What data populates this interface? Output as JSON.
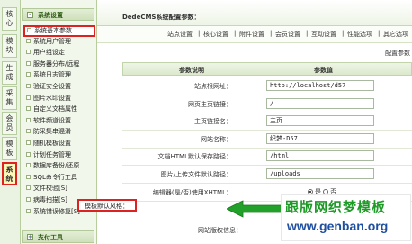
{
  "vtabs": [
    {
      "label": "核心",
      "active": false
    },
    {
      "label": "模块",
      "active": false
    },
    {
      "label": "生成",
      "active": false
    },
    {
      "label": "采集",
      "active": false
    },
    {
      "label": "会员",
      "active": false
    },
    {
      "label": "模板",
      "active": false
    },
    {
      "label": "系统",
      "active": true
    }
  ],
  "menu": {
    "section1": "系统设置",
    "items": [
      "系统基本参数",
      "系统用户管理",
      "用户组设定",
      "服务器分布/远程",
      "系统日志管理",
      "验证安全设置",
      "图片水印设置",
      "自定义文档属性",
      "软件频道设置",
      "防采集串混淆",
      "随机模板设置",
      "计划任务管理",
      "数据库备份/还原",
      "SQL命令行工具",
      "文件校验[S]",
      "病毒扫描[S]",
      "系统错误修复[S]"
    ],
    "section2": "支付工具"
  },
  "main": {
    "title": "DedeCMS系统配置参数：",
    "tabs": [
      "站点设置",
      "|",
      "核心设置",
      "|",
      "附件设置",
      "|",
      "会员设置",
      "|",
      "互动设置",
      "|",
      "性能选项",
      "|",
      "其它选项"
    ],
    "section_title": "配置参数",
    "grid": {
      "col1": "参数说明",
      "col2": "参数值",
      "rows": [
        {
          "label": "站点根网址：",
          "value": "http://localhost/d57",
          "type": "input"
        },
        {
          "label": "网页主页链接：",
          "value": "/",
          "type": "input"
        },
        {
          "label": "主页链接名：",
          "value": "主页",
          "type": "input"
        },
        {
          "label": "网站名称：",
          "value": "织梦-D57",
          "type": "input"
        },
        {
          "label": "文档HTML默认保存路径：",
          "value": "/html",
          "type": "input"
        },
        {
          "label": "图片/上传文件默认路径：",
          "value": "/uploads",
          "type": "input"
        },
        {
          "label": "编辑器(是/否)使用XHTML：",
          "value": "",
          "type": "radio"
        }
      ],
      "radio_yes": "是",
      "radio_no": "否",
      "highlight_label": "模板默认风格：",
      "bottom_label": "网站版权信息："
    }
  },
  "watermark": {
    "cn": "跟版网织梦模板",
    "url": "www.genban.org"
  },
  "colors": {
    "highlight": "#dd2222",
    "green": "#1f9a28",
    "blue": "#1f4fa0"
  }
}
